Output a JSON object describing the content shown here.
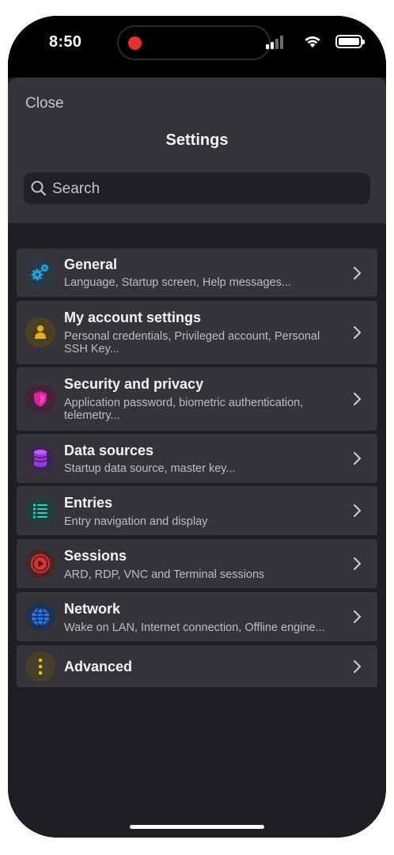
{
  "status_bar": {
    "time": "8:50"
  },
  "header": {
    "close_label": "Close",
    "title": "Settings",
    "search_placeholder": "Search"
  },
  "settings": [
    {
      "title": "General",
      "subtitle": "Language, Startup screen, Help messages...",
      "icon": "gears-icon",
      "color": "#1fa6e0"
    },
    {
      "title": "My account settings",
      "subtitle": "Personal credentials, Privileged account, Personal SSH Key...",
      "icon": "person-icon",
      "color": "#e8b20e"
    },
    {
      "title": "Security and privacy",
      "subtitle": "Application password, biometric authentication, telemetry...",
      "icon": "shield-icon",
      "color": "#e0209e"
    },
    {
      "title": "Data sources",
      "subtitle": "Startup data source, master key...",
      "icon": "database-icon",
      "color": "#9a33f0"
    },
    {
      "title": "Entries",
      "subtitle": "Entry navigation and display",
      "icon": "list-icon",
      "color": "#2ad0b8"
    },
    {
      "title": "Sessions",
      "subtitle": "ARD, RDP, VNC and Terminal sessions",
      "icon": "play-icon",
      "color": "#e0302b"
    },
    {
      "title": "Network",
      "subtitle": "Wake on LAN, Internet connection, Offline engine...",
      "icon": "globe-icon",
      "color": "#2a78e8"
    },
    {
      "title": "Advanced",
      "subtitle": "",
      "icon": "more-vertical-icon",
      "color": "#e6c012"
    }
  ]
}
